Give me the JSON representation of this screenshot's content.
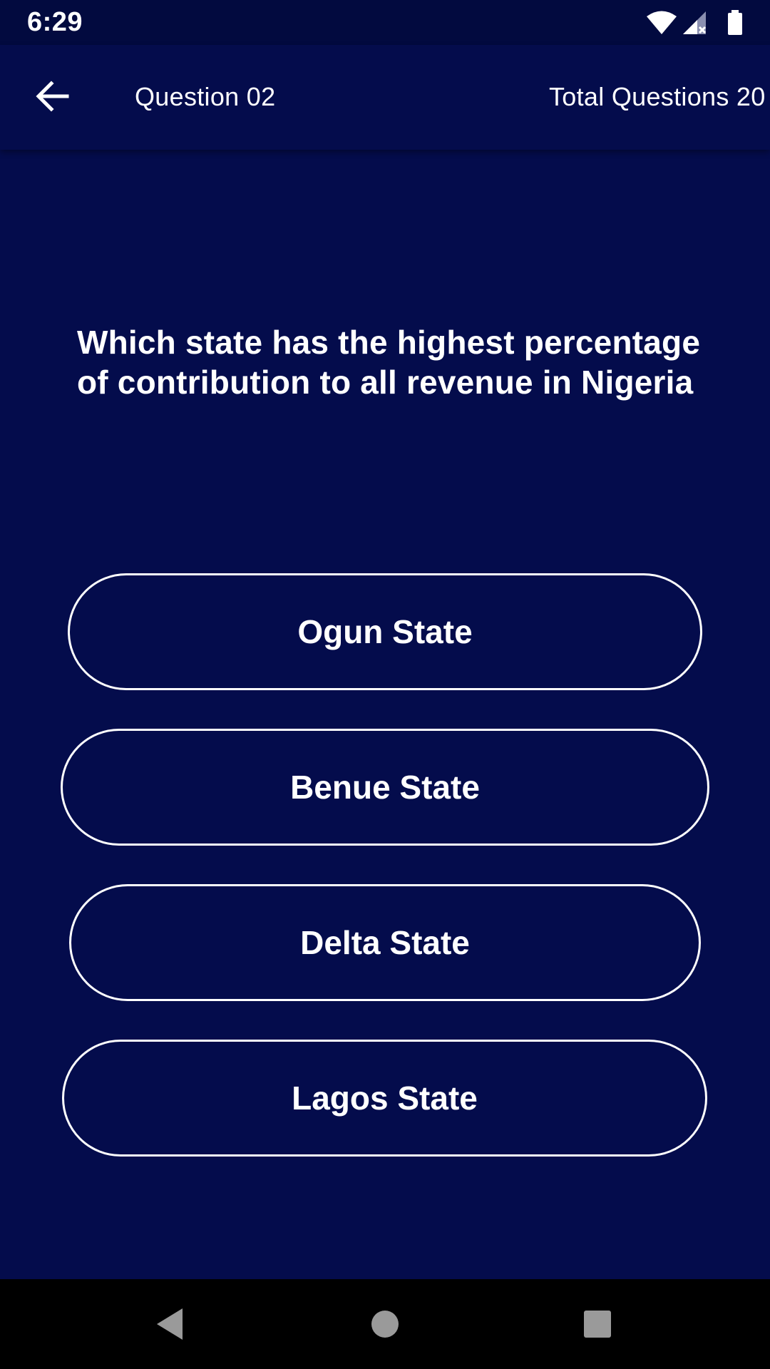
{
  "status_bar": {
    "time": "6:29",
    "icons": [
      "wifi-icon",
      "cell-signal-icon",
      "battery-icon"
    ]
  },
  "app_bar": {
    "back_icon": "arrow-left-icon",
    "question_number": "Question 02",
    "total_questions": "Total Questions 20"
  },
  "quiz": {
    "question": "Which state has the highest percentage of contribution to all revenue in Nigeria",
    "options": [
      {
        "label": "Ogun State"
      },
      {
        "label": "Benue State"
      },
      {
        "label": "Delta State"
      },
      {
        "label": "Lagos State"
      }
    ]
  },
  "nav_bar": {
    "icons": [
      "back-triangle-icon",
      "home-circle-icon",
      "recents-square-icon"
    ]
  },
  "colors": {
    "background": "#040c4c",
    "status_bar": "#020a3f",
    "text": "#ffffff",
    "nav_bar": "#000000"
  }
}
